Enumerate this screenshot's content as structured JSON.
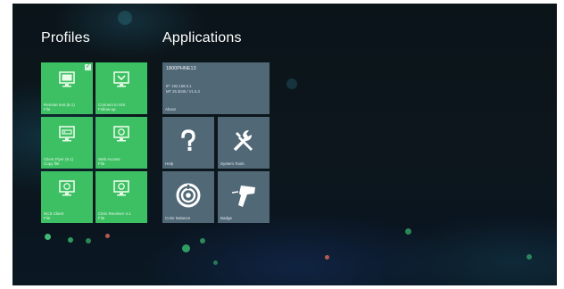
{
  "profiles": {
    "title": "Profiles",
    "tiles": [
      {
        "label": "Remote test (6.1)\nFile",
        "icon": "monitor-icon"
      },
      {
        "label": "Connect to ISS\nFollow-up",
        "icon": "monitor-download-icon"
      },
      {
        "label": "Client Flyer (6.1)\nCopy file",
        "icon": "monitor-drive-icon"
      },
      {
        "label": "Web Access\nFile",
        "icon": "monitor-browser-icon"
      },
      {
        "label": "NCS Client\nFile",
        "icon": "monitor-browser-icon"
      },
      {
        "label": "Citrix Receiver 4.1\nFile",
        "icon": "monitor-browser-icon"
      }
    ]
  },
  "applications": {
    "title": "Applications",
    "detail": {
      "title": "1800PHNE13",
      "lines": [
        "IP: 192.168.0.1",
        "MT 25.3045 / V1.5.3"
      ],
      "label": "About"
    },
    "tiles": [
      {
        "label": "Help",
        "icon": "question-mark-icon"
      },
      {
        "label": "System Tools",
        "icon": "tools-icon"
      },
      {
        "label": "Color Balance",
        "icon": "color-wheel-icon"
      },
      {
        "label": "Badge",
        "icon": "barcode-scanner-icon"
      }
    ]
  },
  "colors": {
    "profile_tile": "#3cc063",
    "app_tile": "#516877",
    "background": "#0b1419"
  }
}
